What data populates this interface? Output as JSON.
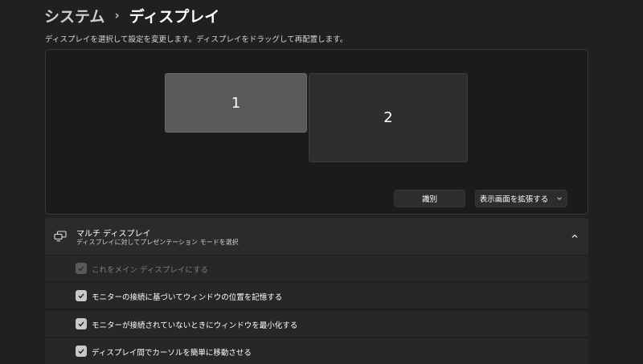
{
  "breadcrumb": {
    "parent": "システム",
    "separator": "›",
    "current": "ディスプレイ"
  },
  "subtitle": "ディスプレイを選択して設定を変更します。ディスプレイをドラッグして再配置します。",
  "arrangement": {
    "monitors": [
      {
        "label": "1",
        "selected": true
      },
      {
        "label": "2",
        "selected": false
      }
    ],
    "identify_label": "識別",
    "mode_dropdown": {
      "selected": "表示画面を拡張する",
      "icon": "chevron-down-icon"
    }
  },
  "multi_display": {
    "icon": "multi-monitor-icon",
    "title": "マルチ ディスプレイ",
    "description": "ディスプレイに対してプレゼンテーション モードを選択",
    "expanded": true,
    "collapse_icon": "chevron-up-icon",
    "options": [
      {
        "label": "これをメイン ディスプレイにする",
        "checked": true,
        "enabled": false
      },
      {
        "label": "モニターの接続に基づいてウィンドウの位置を記憶する",
        "checked": true,
        "enabled": true
      },
      {
        "label": "モニターが接続されていないときにウィンドウを最小化する",
        "checked": true,
        "enabled": true
      },
      {
        "label": "ディスプレイ間でカーソルを簡単に移動させる",
        "checked": true,
        "enabled": true
      }
    ]
  },
  "colors": {
    "background": "#202020",
    "panel": "#1b1b1b",
    "card": "#2b2b2b",
    "selected_monitor": "#595959",
    "checkbox": "#c9c9c9"
  }
}
